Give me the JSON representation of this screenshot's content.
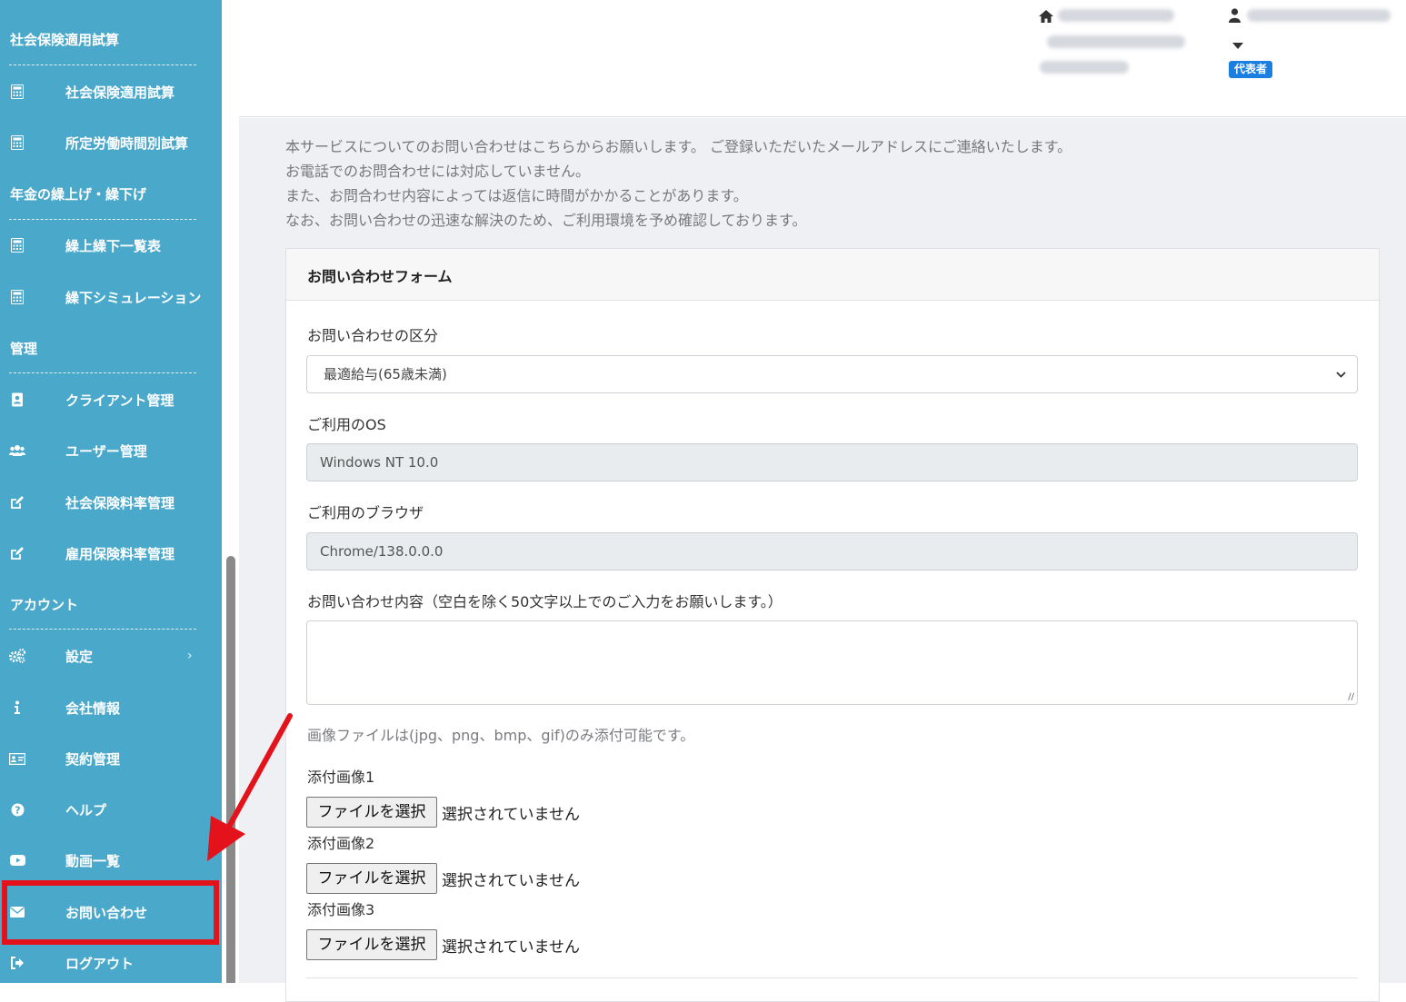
{
  "sidebar": {
    "sections": [
      {
        "title": "社会保険適用試算"
      },
      {
        "title": "年金の繰上げ・繰下げ"
      },
      {
        "title": "管理"
      },
      {
        "title": "アカウント"
      }
    ],
    "items": [
      {
        "label": "社会保険適用試算",
        "icon": "calculator-icon"
      },
      {
        "label": "所定労働時間別試算",
        "icon": "calculator-icon"
      },
      {
        "label": "繰上繰下一覧表",
        "icon": "calculator-icon"
      },
      {
        "label": "繰下シミュレーション",
        "icon": "calculator-icon"
      },
      {
        "label": "クライアント管理",
        "icon": "address-book-icon"
      },
      {
        "label": "ユーザー管理",
        "icon": "users-icon"
      },
      {
        "label": "社会保険料率管理",
        "icon": "edit-icon"
      },
      {
        "label": "雇用保険料率管理",
        "icon": "edit-icon"
      },
      {
        "label": "設定",
        "icon": "cogs-icon"
      },
      {
        "label": "会社情報",
        "icon": "info-icon"
      },
      {
        "label": "契約管理",
        "icon": "id-card-icon"
      },
      {
        "label": "ヘルプ",
        "icon": "question-circle-icon"
      },
      {
        "label": "動画一覧",
        "icon": "youtube-icon"
      },
      {
        "label": "お問い合わせ",
        "icon": "envelope-icon"
      },
      {
        "label": "ログアウト",
        "icon": "sign-out-icon"
      }
    ]
  },
  "header": {
    "role_badge": "代表者"
  },
  "notice": {
    "lines": [
      "本サービスについてのお問い合わせはこちらからお願いします。 ご登録いただいたメールアドレスにご連絡いたします。",
      "お電話でのお問合わせには対応していません。",
      "また、お問合わせ内容によっては返信に時間がかかることがあります。",
      "なお、お問い合わせの迅速な解決のため、ご利用環境を予め確認しております。"
    ]
  },
  "form": {
    "title": "お問い合わせフォーム",
    "category_label": "お問い合わせの区分",
    "category_value": "最適給与(65歳未満)",
    "os_label": "ご利用のOS",
    "os_value": "Windows NT 10.0",
    "browser_label": "ご利用のブラウザ",
    "browser_value": "Chrome/138.0.0.0",
    "content_label": "お問い合わせ内容（空白を除く50文字以上でのご入力をお願いします。）",
    "content_value": "",
    "image_hint": "画像ファイルは(jpg、png、bmp、gif)のみ添付可能です。",
    "attachments": [
      {
        "label": "添付画像1",
        "button": "ファイルを選択",
        "status": "選択されていません"
      },
      {
        "label": "添付画像2",
        "button": "ファイルを選択",
        "status": "選択されていません"
      },
      {
        "label": "添付画像3",
        "button": "ファイルを選択",
        "status": "選択されていません"
      }
    ]
  },
  "colors": {
    "sidebar_bg": "#4aa8cb",
    "main_bg": "#eff0f4",
    "badge_bg": "#1a7fe0",
    "highlight": "#e3121b"
  }
}
